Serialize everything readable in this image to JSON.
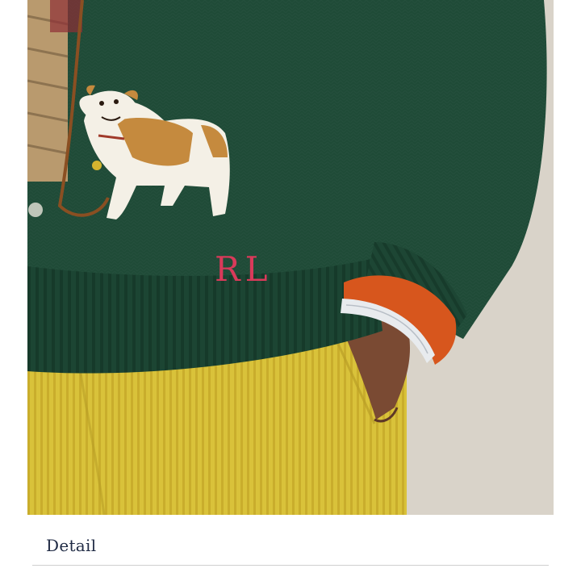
{
  "product_image": {
    "description_icon": "product-photo",
    "embroidered_monogram": "RL"
  },
  "detail_section": {
    "title": "Detail"
  }
}
